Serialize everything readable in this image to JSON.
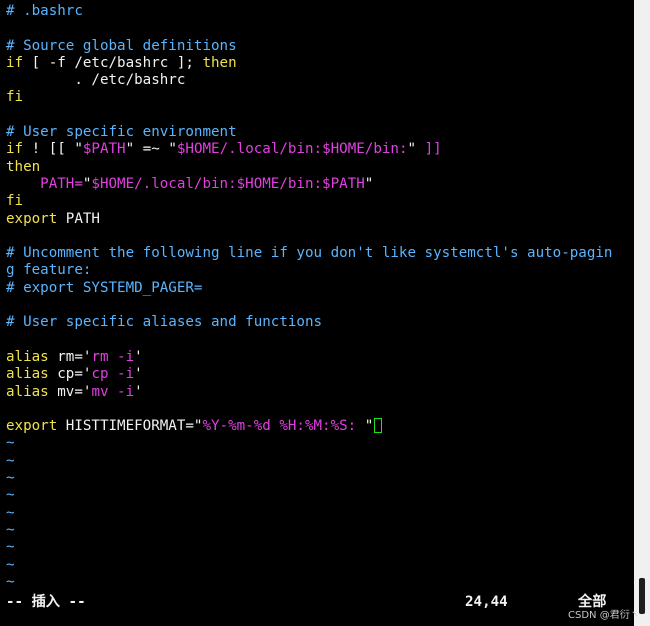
{
  "editor": {
    "lines": [
      [
        {
          "t": "# .bashrc",
          "c": "comment"
        }
      ],
      [],
      [
        {
          "t": "# Source global definitions",
          "c": "comment"
        }
      ],
      [
        {
          "t": "if",
          "c": "keyword"
        },
        {
          "t": " [ -f /etc/bashrc ]; ",
          "c": "plain"
        },
        {
          "t": "then",
          "c": "keyword"
        }
      ],
      [
        {
          "t": "        . /etc/bashrc",
          "c": "plain"
        }
      ],
      [
        {
          "t": "fi",
          "c": "keyword"
        }
      ],
      [],
      [
        {
          "t": "# User specific environment",
          "c": "comment"
        }
      ],
      [
        {
          "t": "if",
          "c": "keyword"
        },
        {
          "t": " ! [[ ",
          "c": "plain"
        },
        {
          "t": "\"",
          "c": "punct"
        },
        {
          "t": "$PATH",
          "c": "string"
        },
        {
          "t": "\"",
          "c": "punct"
        },
        {
          "t": " =~ ",
          "c": "plain"
        },
        {
          "t": "\"",
          "c": "punct"
        },
        {
          "t": "$HOME/.local/bin:$HOME/bin:",
          "c": "string"
        },
        {
          "t": "\"",
          "c": "punct"
        },
        {
          "t": " ]]",
          "c": "string"
        }
      ],
      [
        {
          "t": "then",
          "c": "keyword"
        }
      ],
      [
        {
          "t": "    PATH=",
          "c": "string"
        },
        {
          "t": "\"",
          "c": "punct"
        },
        {
          "t": "$HOME/.local/bin:$HOME/bin:$PATH",
          "c": "string"
        },
        {
          "t": "\"",
          "c": "punct"
        }
      ],
      [
        {
          "t": "fi",
          "c": "keyword"
        }
      ],
      [
        {
          "t": "export",
          "c": "keyword"
        },
        {
          "t": " PATH",
          "c": "plain"
        }
      ],
      [],
      [
        {
          "t": "# Uncomment the following line if you don't like systemctl's auto-pagin",
          "c": "comment"
        }
      ],
      [
        {
          "t": "g feature:",
          "c": "comment"
        }
      ],
      [
        {
          "t": "# export SYSTEMD_PAGER=",
          "c": "comment"
        }
      ],
      [],
      [
        {
          "t": "# User specific aliases and functions",
          "c": "comment"
        }
      ],
      [],
      [
        {
          "t": "alias",
          "c": "keyword"
        },
        {
          "t": " rm=",
          "c": "plain"
        },
        {
          "t": "'",
          "c": "punct"
        },
        {
          "t": "rm -i",
          "c": "string"
        },
        {
          "t": "'",
          "c": "punct"
        }
      ],
      [
        {
          "t": "alias",
          "c": "keyword"
        },
        {
          "t": " cp=",
          "c": "plain"
        },
        {
          "t": "'",
          "c": "punct"
        },
        {
          "t": "cp -i",
          "c": "string"
        },
        {
          "t": "'",
          "c": "punct"
        }
      ],
      [
        {
          "t": "alias",
          "c": "keyword"
        },
        {
          "t": " mv=",
          "c": "plain"
        },
        {
          "t": "'",
          "c": "punct"
        },
        {
          "t": "mv -i",
          "c": "string"
        },
        {
          "t": "'",
          "c": "punct"
        }
      ],
      [],
      [
        {
          "t": "export",
          "c": "keyword"
        },
        {
          "t": " HISTTIMEFORMAT=",
          "c": "plain"
        },
        {
          "t": "\"",
          "c": "punct"
        },
        {
          "t": "%Y-%m-%d %H:%M:%S: ",
          "c": "string"
        },
        {
          "t": "\"",
          "c": "punct"
        },
        {
          "cursor": true
        }
      ],
      [
        {
          "t": "~",
          "c": "tilde"
        }
      ],
      [
        {
          "t": "~",
          "c": "tilde"
        }
      ],
      [
        {
          "t": "~",
          "c": "tilde"
        }
      ],
      [
        {
          "t": "~",
          "c": "tilde"
        }
      ],
      [
        {
          "t": "~",
          "c": "tilde"
        }
      ],
      [
        {
          "t": "~",
          "c": "tilde"
        }
      ],
      [
        {
          "t": "~",
          "c": "tilde"
        }
      ],
      [
        {
          "t": "~",
          "c": "tilde"
        }
      ],
      [
        {
          "t": "~",
          "c": "tilde"
        }
      ]
    ]
  },
  "status": {
    "mode": "-- 插入 --",
    "position": "24,44",
    "scroll": "全部"
  },
  "watermark": "CSDN @君衍丶",
  "colors": {
    "background": "#000000",
    "comment": "#5ab4ff",
    "keyword": "#f0e24a",
    "string": "#e040e0",
    "text": "#f2f2f2",
    "cursor_border": "#19e619"
  }
}
